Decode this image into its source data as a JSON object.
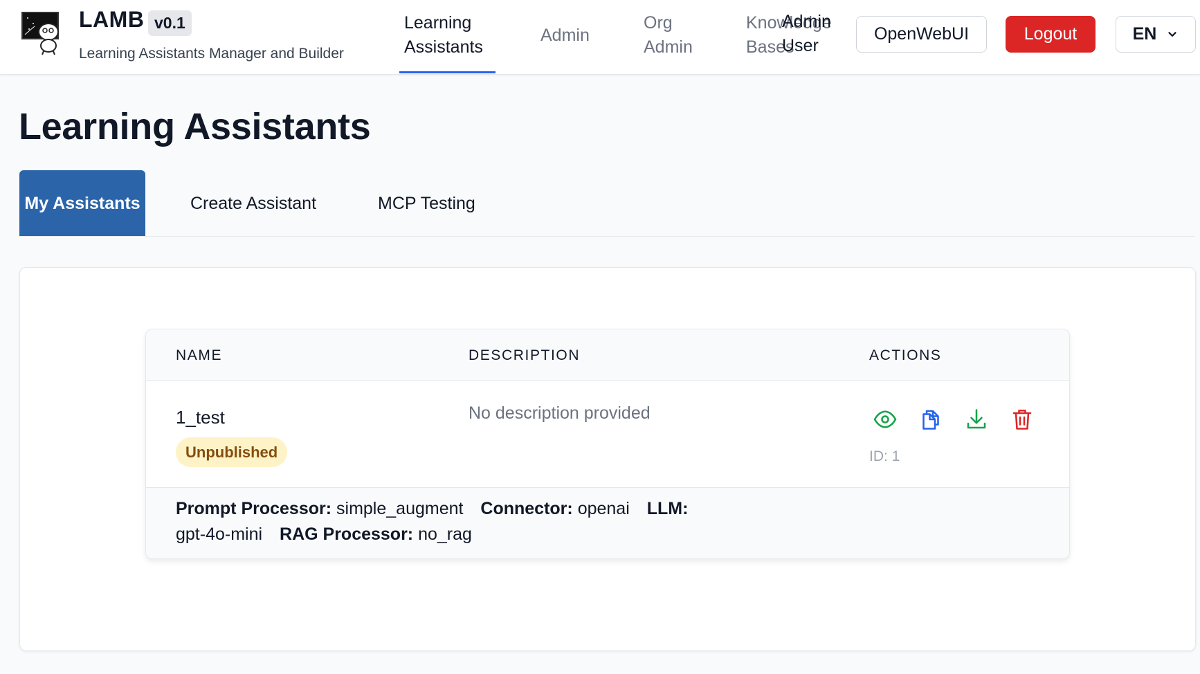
{
  "app": {
    "title": "LAMB",
    "version": "v0.1",
    "subtitle": "Learning Assistants Manager and Builder"
  },
  "nav": {
    "items": [
      {
        "line1": "Learning",
        "line2": "Assistants",
        "active": true
      },
      {
        "line1": "Admin",
        "line2": ""
      },
      {
        "line1": "Org",
        "line2": "Admin"
      },
      {
        "line1": "Knowledge",
        "line2": "Bases"
      },
      {
        "line1": "Admin",
        "line2": "User"
      }
    ],
    "openwebui_label": "OpenWebUI",
    "logout_label": "Logout",
    "language": "EN"
  },
  "page": {
    "title": "Learning Assistants",
    "tabs": [
      {
        "label": "My Assistants",
        "active": true
      },
      {
        "label": "Create Assistant"
      },
      {
        "label": "MCP Testing"
      }
    ]
  },
  "table": {
    "headers": {
      "name": "NAME",
      "description": "DESCRIPTION",
      "actions": "ACTIONS"
    },
    "rows": [
      {
        "name": "1_test",
        "status": "Unpublished",
        "description": "No description provided",
        "id_text": "ID: 1",
        "actions": [
          {
            "icon": "eye-icon",
            "color": "#16a34a"
          },
          {
            "icon": "copy-icon",
            "color": "#2563eb"
          },
          {
            "icon": "download-icon",
            "color": "#16a34a"
          },
          {
            "icon": "trash-icon",
            "color": "#dc2626"
          }
        ],
        "details": {
          "prompt_processor_label": "Prompt Processor:",
          "prompt_processor": "simple_augment",
          "connector_label": "Connector:",
          "connector": "openai",
          "llm_label": "LLM:",
          "llm": "gpt-4o-mini",
          "rag_processor_label": "RAG Processor:",
          "rag_processor": "no_rag"
        }
      }
    ]
  },
  "colors": {
    "accent": "#2563eb",
    "tab_active": "#2b64a8",
    "logout": "#dc2626",
    "badge_bg": "#fef3c7",
    "badge_text": "#854d0e"
  }
}
